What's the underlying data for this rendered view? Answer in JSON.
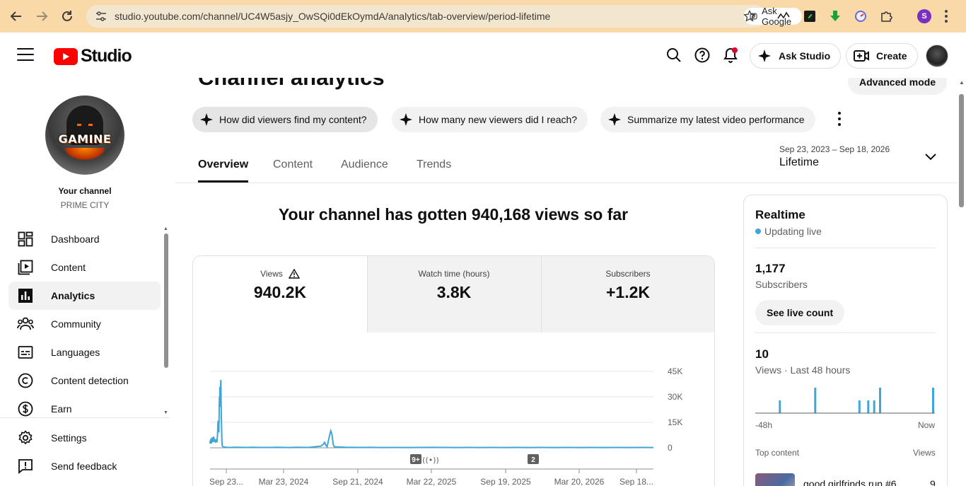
{
  "browser": {
    "url": "studio.youtube.com/channel/UC4W5asjy_OwSQi0dEkOymdA/analytics/tab-overview/period-lifetime",
    "ask_google": "Ask Google",
    "profile_initial": "S"
  },
  "header": {
    "logo_text": "Studio",
    "ask_studio": "Ask Studio",
    "create": "Create"
  },
  "sidebar": {
    "avatar_text": "GAMINE",
    "your_channel": "Your channel",
    "channel_name": "PRIME CITY",
    "items": [
      {
        "label": "Dashboard",
        "icon": "dashboard-icon"
      },
      {
        "label": "Content",
        "icon": "content-icon"
      },
      {
        "label": "Analytics",
        "icon": "analytics-icon",
        "active": true
      },
      {
        "label": "Community",
        "icon": "community-icon"
      },
      {
        "label": "Languages",
        "icon": "languages-icon"
      },
      {
        "label": "Content detection",
        "icon": "copyright-icon"
      },
      {
        "label": "Earn",
        "icon": "earn-icon"
      },
      {
        "label": "Settings",
        "icon": "settings-icon"
      },
      {
        "label": "Send feedback",
        "icon": "feedback-icon"
      }
    ]
  },
  "main": {
    "title": "Channel analytics",
    "advanced_mode": "Advanced mode",
    "chips": [
      "How did viewers find my content?",
      "How many new viewers did I reach?",
      "Summarize my latest video performance"
    ],
    "tabs": [
      "Overview",
      "Content",
      "Audience",
      "Trends"
    ],
    "date_range": "Sep 23, 2023 – Sep 18, 2026",
    "date_label": "Lifetime",
    "headline": "Your channel has gotten 940,168 views so far",
    "metrics": [
      {
        "label": "Views",
        "value": "940.2K"
      },
      {
        "label": "Watch time (hours)",
        "value": "3.8K"
      },
      {
        "label": "Subscribers",
        "value": "+1.2K"
      }
    ],
    "markers": [
      "9+",
      "2"
    ]
  },
  "chart_data": [
    {
      "type": "line",
      "series": [
        {
          "values": [
            [
              0,
              2500
            ],
            [
              0.02,
              4200
            ],
            [
              0.04,
              3000
            ],
            [
              0.06,
              5200
            ],
            [
              0.08,
              3800
            ],
            [
              0.1,
              4800
            ],
            [
              0.12,
              2600
            ],
            [
              0.14,
              6000
            ],
            [
              0.16,
              3200
            ],
            [
              0.18,
              5600
            ],
            [
              0.2,
              4200
            ],
            [
              0.22,
              6200
            ],
            [
              0.24,
              3800
            ],
            [
              0.26,
              5200
            ],
            [
              0.28,
              3400
            ],
            [
              0.3,
              6600
            ],
            [
              0.32,
              4600
            ],
            [
              0.34,
              5400
            ],
            [
              0.36,
              3800
            ],
            [
              0.38,
              4800
            ],
            [
              0.4,
              3600
            ],
            [
              0.42,
              4200
            ],
            [
              0.44,
              3000
            ],
            [
              0.46,
              4800
            ],
            [
              0.48,
              3400
            ],
            [
              0.5,
              5200
            ],
            [
              0.52,
              3600
            ],
            [
              0.54,
              4400
            ],
            [
              0.56,
              3200
            ],
            [
              0.58,
              5000
            ],
            [
              0.6,
              7200
            ],
            [
              0.62,
              10000
            ],
            [
              0.64,
              14000
            ],
            [
              0.66,
              16000
            ],
            [
              0.68,
              11000
            ],
            [
              0.7,
              13000
            ],
            [
              0.72,
              9000
            ],
            [
              0.74,
              20000
            ],
            [
              0.76,
              30000
            ],
            [
              0.78,
              25000
            ],
            [
              0.8,
              36000
            ],
            [
              0.82,
              24000
            ],
            [
              0.84,
              30000
            ],
            [
              0.86,
              38000
            ],
            [
              0.88,
              40000
            ],
            [
              0.9,
              26000
            ],
            [
              0.92,
              18000
            ],
            [
              0.94,
              12000
            ],
            [
              0.96,
              5000
            ],
            [
              0.98,
              2000
            ],
            [
              1.0,
              1000
            ],
            [
              1.1,
              500
            ],
            [
              1.3,
              300
            ],
            [
              1.6,
              200
            ],
            [
              2.0,
              300
            ],
            [
              2.5,
              250
            ],
            [
              3.0,
              200
            ],
            [
              3.5,
              300
            ],
            [
              4.0,
              200
            ],
            [
              4.5,
              200
            ],
            [
              5.0,
              200
            ],
            [
              5.5,
              300
            ],
            [
              6.0,
              200
            ],
            [
              6.5,
              150
            ],
            [
              7.0,
              300
            ],
            [
              7.5,
              250
            ],
            [
              8.0,
              200
            ],
            [
              9.0,
              1000
            ],
            [
              9.2,
              2000
            ],
            [
              9.3,
              3200
            ],
            [
              9.4,
              1500
            ],
            [
              9.5,
              600
            ],
            [
              9.7,
              7000
            ],
            [
              9.8,
              10000
            ],
            [
              9.9,
              8000
            ],
            [
              10.0,
              2000
            ],
            [
              10.1,
              600
            ],
            [
              11,
              300
            ],
            [
              12,
              200
            ],
            [
              13,
              250
            ],
            [
              14,
              150
            ],
            [
              15,
              200
            ],
            [
              16,
              150
            ],
            [
              17,
              200
            ],
            [
              18,
              250
            ],
            [
              19,
              200
            ],
            [
              20,
              150
            ],
            [
              21,
              200
            ],
            [
              22,
              150
            ],
            [
              23,
              200
            ],
            [
              24,
              150
            ],
            [
              25,
              200
            ],
            [
              26,
              150
            ],
            [
              27,
              200
            ],
            [
              28,
              150
            ],
            [
              29,
              200
            ],
            [
              30,
              150
            ],
            [
              31,
              200
            ],
            [
              32,
              150
            ],
            [
              33,
              200
            ],
            [
              34,
              150
            ],
            [
              35,
              200
            ],
            [
              36,
              150
            ]
          ]
        }
      ],
      "y_ticks": [
        "0",
        "15K",
        "30K",
        "45K"
      ],
      "x_labels": [
        "Sep 23...",
        "Mar 23, 2024",
        "Sep 21, 2024",
        "Mar 22, 2025",
        "Sep 19, 2025",
        "Mar 20, 2026",
        "Sep 18..."
      ],
      "ylim": [
        0,
        45000
      ]
    },
    {
      "type": "bar",
      "values": [
        0,
        0,
        0,
        0,
        0,
        0,
        0,
        0,
        1,
        0,
        0,
        0,
        0,
        0,
        0,
        0,
        0,
        0,
        0,
        0,
        2,
        0,
        0,
        0,
        0,
        0,
        0,
        0,
        0,
        0,
        0,
        0,
        0,
        0,
        0,
        1,
        0,
        0,
        1,
        0,
        1,
        0,
        2,
        0,
        0,
        0,
        0,
        0,
        0,
        0,
        0,
        0,
        0,
        0,
        0,
        0,
        0,
        0,
        0,
        0,
        2
      ]
    }
  ],
  "realtime": {
    "title": "Realtime",
    "status": "Updating live",
    "subscribers_value": "1,177",
    "subscribers_label": "Subscribers",
    "see_live_count": "See live count",
    "views_value": "10",
    "views_label": "Views · Last 48 hours",
    "axis_left": "-48h",
    "axis_right": "Now",
    "top_content": "Top content",
    "views_col": "Views",
    "top_item_title": "good girlfrinds run #6",
    "top_item_views": "9"
  },
  "colors": {
    "chrome_bg": "#f9d9a8",
    "accent_chart": "#3ea6d8",
    "brand_red": "#ff0000"
  }
}
